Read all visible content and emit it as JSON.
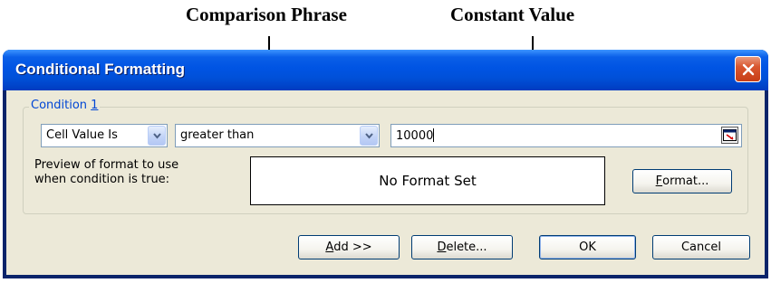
{
  "annotations": {
    "comparison": "Comparison Phrase",
    "constant": "Constant Value"
  },
  "window": {
    "title": "Conditional Formatting",
    "close_icon": "close-icon"
  },
  "condition": {
    "legend_text": "Condition ",
    "legend_num": "1",
    "cell_value_selected": "Cell Value Is",
    "operator_selected": "greater than",
    "value": "10000",
    "ref_icon": "collapse-dialog-icon"
  },
  "preview": {
    "label_line1": "Preview of format to use",
    "label_line2": "when condition is true:",
    "text": "No Format Set"
  },
  "buttons": {
    "format_mnemonic": "F",
    "format_rest": "ormat...",
    "add_mnemonic": "A",
    "add_rest": "dd >>",
    "delete_mnemonic": "D",
    "delete_rest": "elete...",
    "ok": "OK",
    "cancel": "Cancel"
  },
  "colors": {
    "titlebar": "#0054e3",
    "dialog_bg": "#ece9d8",
    "legend_text": "#0046d5",
    "close_button": "#d9572f"
  }
}
